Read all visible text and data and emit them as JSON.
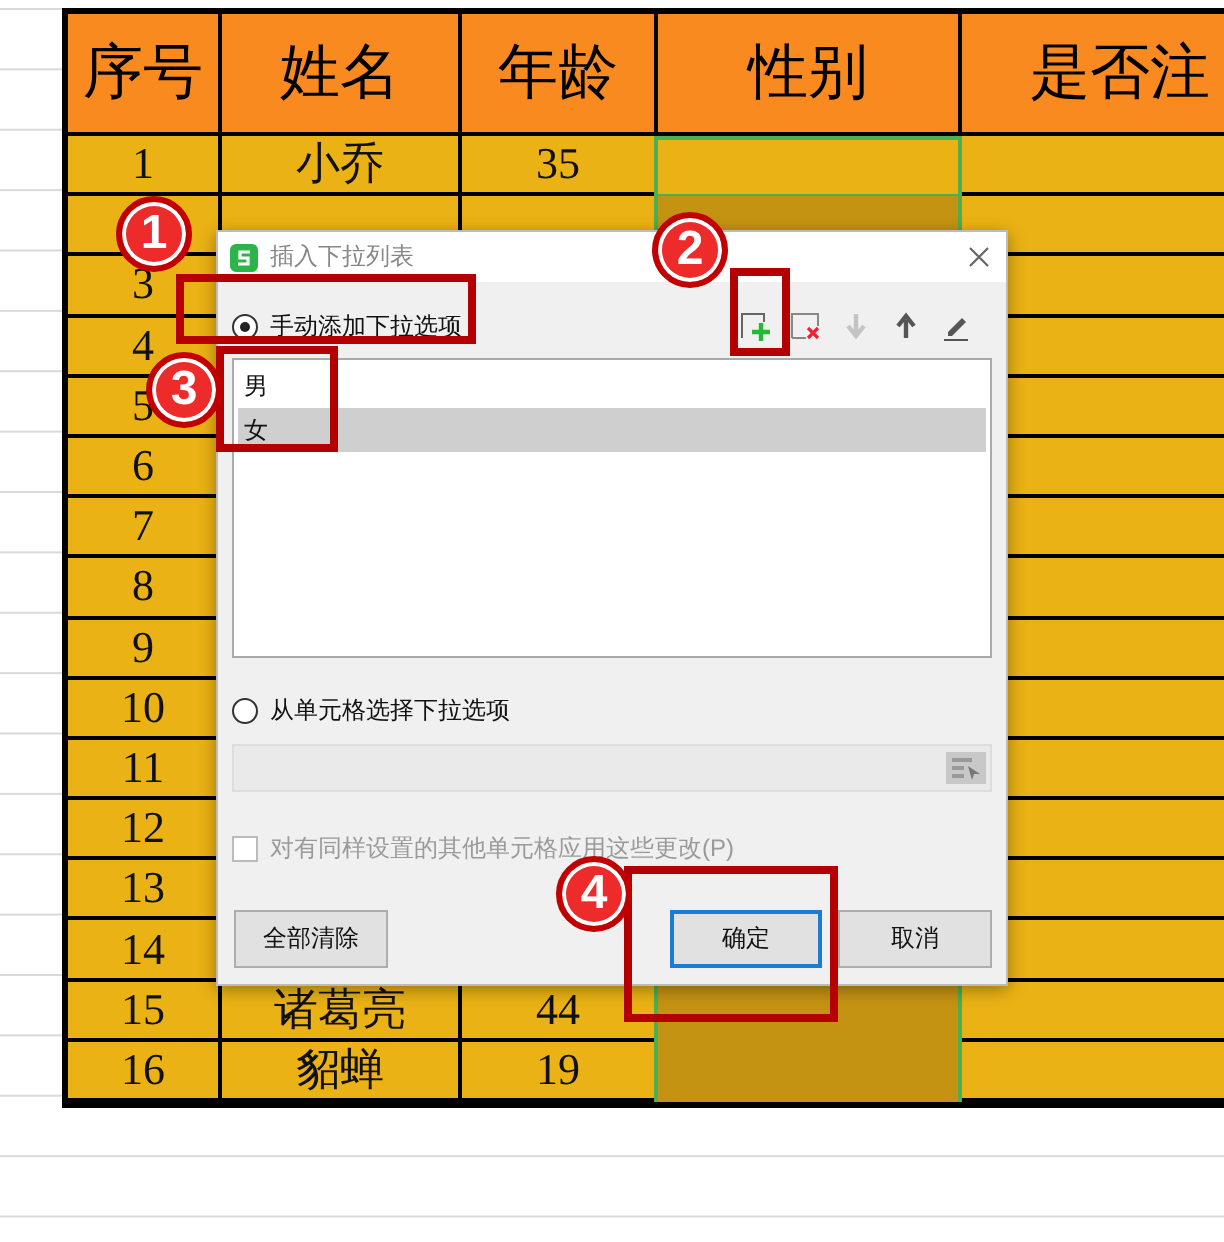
{
  "sheet": {
    "columns": [
      "序号",
      "姓名",
      "年龄",
      "性别",
      "是否注"
    ],
    "rows": [
      {
        "no": "1",
        "name": "小乔",
        "age": "35",
        "active": true
      },
      {
        "active": false
      },
      {
        "no": "3"
      },
      {
        "no": "4"
      },
      {
        "no": "5"
      },
      {
        "no": "6"
      },
      {
        "no": "7"
      },
      {
        "no": "8"
      },
      {
        "no": "9"
      },
      {
        "no": "10"
      },
      {
        "no": "11"
      },
      {
        "no": "12"
      },
      {
        "no": "13"
      },
      {
        "no": "14"
      },
      {
        "no": "15",
        "name": "诸葛亮",
        "age": "44",
        "active": false
      },
      {
        "no": "16",
        "name": "貂蝉",
        "age": "19",
        "active": false
      }
    ]
  },
  "dialog": {
    "title": "插入下拉列表",
    "options": [
      {
        "label": "手动添加下拉选项",
        "selected": true
      },
      {
        "label": "从单元格选择下拉选项",
        "selected": false
      }
    ],
    "toolbar": [
      {
        "kind": "add",
        "disabled": false
      },
      {
        "kind": "delete",
        "disabled": false
      },
      {
        "kind": "down",
        "disabled": true
      },
      {
        "kind": "up",
        "disabled": false
      },
      {
        "kind": "edit",
        "disabled": false
      }
    ],
    "items": [
      {
        "label": "男",
        "selected": false
      },
      {
        "label": "女",
        "selected": true
      }
    ],
    "range_field": {
      "disabled": true
    },
    "apply_all": {
      "label": "对有同样设置的其他单元格应用这些更改(P)",
      "checked": false,
      "disabled": true
    },
    "buttons": [
      {
        "label": "全部清除",
        "focused": false
      },
      {
        "label": "确定",
        "focused": true
      },
      {
        "label": "取消",
        "focused": false
      }
    ]
  },
  "markers": [
    "1",
    "2",
    "3",
    "4"
  ]
}
